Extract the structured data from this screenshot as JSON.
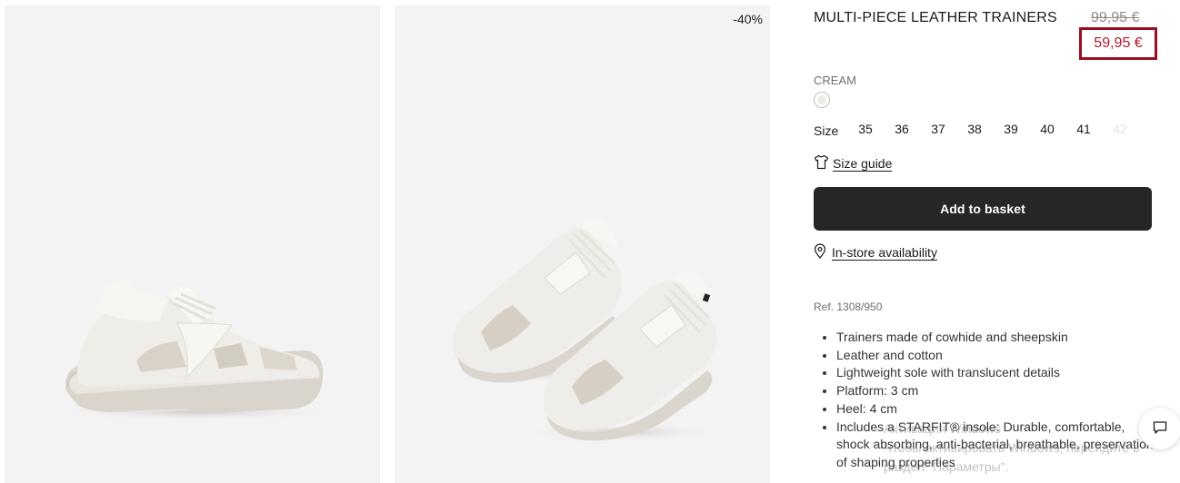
{
  "gallery": {
    "image1_alt": "",
    "image2_alt": "",
    "discount_badge": "-40%"
  },
  "product": {
    "title": "MULTI-PIECE LEATHER TRAINERS",
    "old_price": "99,95 €",
    "new_price": "59,95 €",
    "color_name": "CREAM",
    "size_label": "Size",
    "sizes": [
      {
        "label": "35",
        "available": true
      },
      {
        "label": "36",
        "available": true
      },
      {
        "label": "37",
        "available": true
      },
      {
        "label": "38",
        "available": true
      },
      {
        "label": "39",
        "available": true
      },
      {
        "label": "40",
        "available": true
      },
      {
        "label": "41",
        "available": true
      },
      {
        "label": "42",
        "available": false
      }
    ],
    "size_guide": "Size guide",
    "add_to_basket": "Add to basket",
    "in_store": "In-store availability",
    "ref": "Ref. 1308/950",
    "features": [
      "Trainers made of cowhide and sheepskin",
      "Leather and cotton",
      "Lightweight sole with translucent details",
      "Platform: 3 cm",
      "Heel: 4 cm",
      "Includes a STARFIT® insole: Durable, comfortable, shock absorbing, anti-bacterial, breathable, preservation of shaping properties"
    ]
  },
  "overlay": {
    "watermark_line1": "Активация Windows",
    "watermark_line2": "Чтобы активировать Windows, перейдите в",
    "watermark_line3": "раздел \"Параметры\"."
  },
  "colors": {
    "sale_red": "#b3182b",
    "button_bg": "#262626",
    "panel_bg": "#f3f3f3"
  },
  "icons": {
    "size_guide": "tshirt-icon",
    "in_store": "location-pin-icon",
    "chat": "chat-icon"
  }
}
